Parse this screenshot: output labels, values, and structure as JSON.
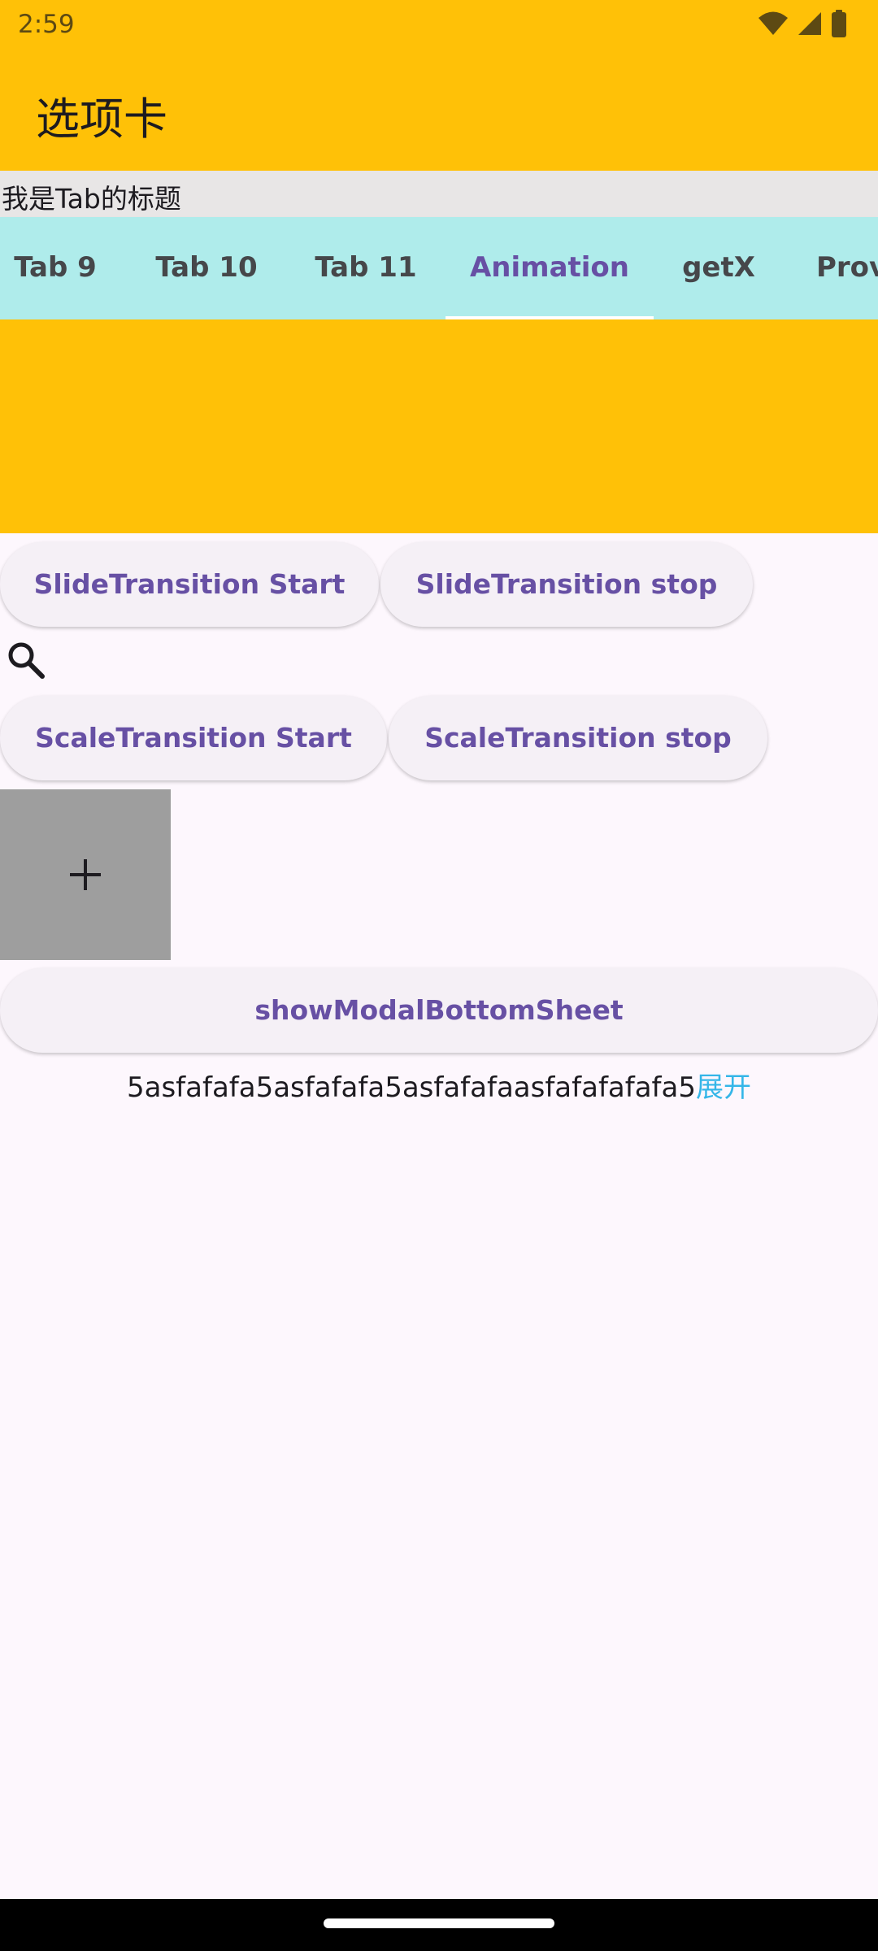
{
  "status_bar": {
    "time": "2:59"
  },
  "app_bar": {
    "title": "选项卡"
  },
  "tab_caption": "我是Tab的标题",
  "tabs": [
    {
      "label": "Tab 9"
    },
    {
      "label": "Tab 10"
    },
    {
      "label": "Tab 11"
    },
    {
      "label": "Animation",
      "selected": true
    },
    {
      "label": "getX"
    },
    {
      "label": "Provi"
    }
  ],
  "buttons": {
    "slide_start": "SlideTransition Start",
    "slide_stop": "SlideTransition stop",
    "scale_start": "ScaleTransition Start",
    "scale_stop": "ScaleTransition stop",
    "modal_sheet": "showModalBottomSheet"
  },
  "expandable_text": {
    "content": "5asfafafa5asfafafa5asfafafaasfafafafafa5",
    "expand_label": "展开"
  },
  "colors": {
    "app_bar": "#FFC107",
    "tab_bar": "#AFECEB",
    "accent": "#6750A4",
    "link": "#35B6E8",
    "box": "#9E9E9E"
  },
  "icons": [
    "wifi-icon",
    "signal-icon",
    "battery-icon",
    "search-icon",
    "plus-icon"
  ]
}
